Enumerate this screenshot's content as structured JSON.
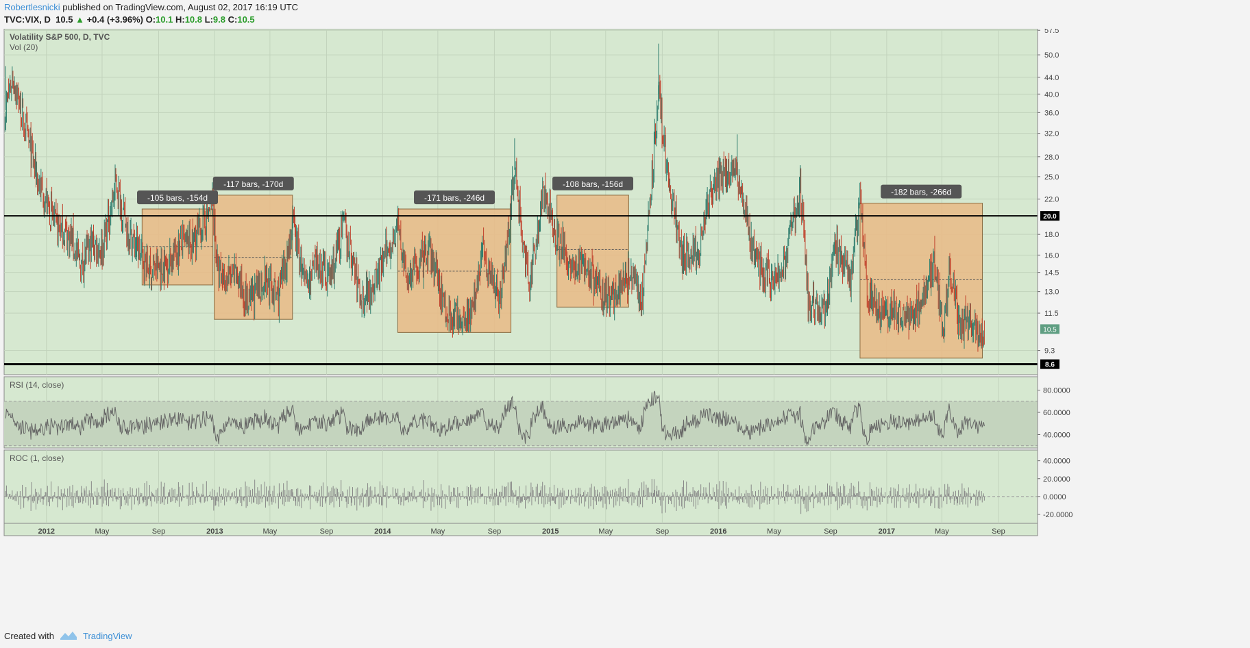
{
  "header": {
    "author": "Robertlesnicki",
    "published": "published on TradingView.com, August 02, 2017 16:19 UTC",
    "symbol": "TVC:VIX, D",
    "last": "10.5",
    "change": "+0.4 (+3.96%)",
    "o_label": "O:",
    "o_val": "10.1",
    "h_label": "H:",
    "h_val": "10.8",
    "l_label": "L:",
    "l_val": "9.8",
    "c_label": "C:",
    "c_val": "10.5"
  },
  "footer": {
    "created_with": "Created with",
    "brand": "TradingView"
  },
  "colors": {
    "bg": "#d6e8d0",
    "rect": "#e8bb87",
    "rect_border": "#8a6a40",
    "candle_up": "#2e7d6e",
    "candle_down": "#c0402b",
    "line": "#000000",
    "label_bg": "#555555",
    "rsi_band": "#c4d4be",
    "osc": "#666666"
  },
  "chart_data": [
    {
      "type": "candlestick",
      "title": "Volatility S&P 500, D, TVC",
      "subtitle": "Vol (20)",
      "y_ticks": [
        "57.5",
        "50.0",
        "44.0",
        "40.0",
        "36.0",
        "32.0",
        "28.0",
        "25.0",
        "22.0",
        "18.0",
        "16.0",
        "14.5",
        "13.0",
        "11.5",
        "9.3"
      ],
      "y_tick_values": [
        57.5,
        50,
        44,
        40,
        36,
        32,
        28,
        25,
        22,
        18,
        16,
        14.5,
        13,
        11.5,
        9.3
      ],
      "y_scale": "log",
      "ylim": [
        8.1,
        58
      ],
      "x_ticks": [
        "2012",
        "May",
        "Sep",
        "2013",
        "May",
        "Sep",
        "2014",
        "May",
        "Sep",
        "2015",
        "May",
        "Sep",
        "2016",
        "May",
        "Sep",
        "2017",
        "May",
        "Sep"
      ],
      "x_tick_dates": [
        "2012-01-01",
        "2012-05-01",
        "2012-09-01",
        "2013-01-01",
        "2013-05-01",
        "2013-09-01",
        "2014-01-01",
        "2014-05-01",
        "2014-09-01",
        "2015-01-01",
        "2015-05-01",
        "2015-09-01",
        "2016-01-01",
        "2016-05-01",
        "2016-09-01",
        "2017-01-01",
        "2017-05-01",
        "2017-09-01"
      ],
      "x_range": [
        "2011-10-01",
        "2017-11-25"
      ],
      "path": [
        [
          "2011-10-03",
          36
        ],
        [
          "2011-10-20",
          44
        ],
        [
          "2011-11-15",
          33
        ],
        [
          "2011-12-15",
          24
        ],
        [
          "2012-01-20",
          19
        ],
        [
          "2012-02-25",
          17.5
        ],
        [
          "2012-03-15",
          15
        ],
        [
          "2012-04-10",
          17
        ],
        [
          "2012-05-01",
          16.5
        ],
        [
          "2012-06-01",
          24
        ],
        [
          "2012-06-20",
          19
        ],
        [
          "2012-07-10",
          17
        ],
        [
          "2012-08-15",
          14.5
        ],
        [
          "2012-09-15",
          15
        ],
        [
          "2012-10-20",
          17
        ],
        [
          "2012-11-15",
          17
        ],
        [
          "2012-12-28",
          21.5
        ],
        [
          "2013-01-08",
          14
        ],
        [
          "2013-02-20",
          14
        ],
        [
          "2013-03-15",
          12
        ],
        [
          "2013-04-20",
          14
        ],
        [
          "2013-05-20",
          12.5
        ],
        [
          "2013-06-20",
          19
        ],
        [
          "2013-07-15",
          13.5
        ],
        [
          "2013-08-15",
          15
        ],
        [
          "2013-09-10",
          14
        ],
        [
          "2013-10-08",
          19
        ],
        [
          "2013-11-15",
          12.5
        ],
        [
          "2013-12-20",
          14
        ],
        [
          "2014-02-03",
          19
        ],
        [
          "2014-02-20",
          14
        ],
        [
          "2014-04-15",
          16
        ],
        [
          "2014-05-20",
          11.5
        ],
        [
          "2014-06-20",
          11
        ],
        [
          "2014-07-20",
          12
        ],
        [
          "2014-08-05",
          16.5
        ],
        [
          "2014-09-15",
          12.5
        ],
        [
          "2014-10-15",
          26
        ],
        [
          "2014-11-15",
          13
        ],
        [
          "2014-12-16",
          23
        ],
        [
          "2015-01-05",
          19
        ],
        [
          "2015-02-20",
          14.5
        ],
        [
          "2015-03-15",
          15.5
        ],
        [
          "2015-04-15",
          13
        ],
        [
          "2015-05-15",
          12.5
        ],
        [
          "2015-06-20",
          14
        ],
        [
          "2015-07-20",
          12.5
        ],
        [
          "2015-08-24",
          40
        ],
        [
          "2015-09-15",
          24
        ],
        [
          "2015-10-15",
          16
        ],
        [
          "2015-11-15",
          16
        ],
        [
          "2015-12-15",
          22
        ],
        [
          "2016-01-20",
          26
        ],
        [
          "2016-02-15",
          25
        ],
        [
          "2016-03-15",
          16
        ],
        [
          "2016-04-15",
          14
        ],
        [
          "2016-05-15",
          14
        ],
        [
          "2016-06-27",
          23
        ],
        [
          "2016-07-15",
          12
        ],
        [
          "2016-08-20",
          11.5
        ],
        [
          "2016-09-12",
          17
        ],
        [
          "2016-10-15",
          14
        ],
        [
          "2016-11-04",
          22
        ],
        [
          "2016-11-20",
          13
        ],
        [
          "2016-12-20",
          11.5
        ],
        [
          "2017-01-20",
          11.5
        ],
        [
          "2017-02-15",
          11
        ],
        [
          "2017-03-20",
          12.5
        ],
        [
          "2017-04-14",
          15.5
        ],
        [
          "2017-05-05",
          10
        ],
        [
          "2017-05-18",
          14.5
        ],
        [
          "2017-06-10",
          10.5
        ],
        [
          "2017-07-01",
          11
        ],
        [
          "2017-07-25",
          9.5
        ],
        [
          "2017-08-02",
          10.5
        ]
      ],
      "horizontal_lines": [
        {
          "value": 20.0,
          "label": "20.0"
        },
        {
          "value": 8.6,
          "label": "8.6"
        }
      ],
      "last_price_label": "10.5",
      "annotations": [
        {
          "label": "-105 bars, -154d",
          "start": "2012-07-27",
          "end": "2012-12-28",
          "high": 20.8,
          "low": 13.5,
          "mid": 16.8
        },
        {
          "label": "-117 bars, -170d",
          "start": "2012-12-31",
          "end": "2013-06-19",
          "high": 22.5,
          "low": 11.1,
          "mid": 15.8
        },
        {
          "label": "-171 bars, -246d",
          "start": "2014-02-03",
          "end": "2014-10-07",
          "high": 20.8,
          "low": 10.3,
          "mid": 14.6
        },
        {
          "label": "-108 bars, -156d",
          "start": "2015-01-15",
          "end": "2015-06-20",
          "high": 22.5,
          "low": 11.9,
          "mid": 16.5
        },
        {
          "label": "-182 bars, -266d",
          "start": "2016-11-04",
          "end": "2017-07-28",
          "high": 21.5,
          "low": 8.9,
          "mid": 13.9
        }
      ]
    },
    {
      "type": "line",
      "title": "RSI (14, close)",
      "y_ticks": [
        "80.0000",
        "60.0000",
        "40.0000"
      ],
      "y_tick_values": [
        80,
        60,
        40
      ],
      "ylim": [
        28,
        92
      ],
      "band": [
        30,
        70
      ]
    },
    {
      "type": "bar",
      "title": "ROC (1, close)",
      "y_ticks": [
        "40.0000",
        "20.0000",
        "0.0000",
        "-20.0000"
      ],
      "y_tick_values": [
        40,
        20,
        0,
        -20
      ],
      "ylim": [
        -30,
        52
      ]
    }
  ]
}
